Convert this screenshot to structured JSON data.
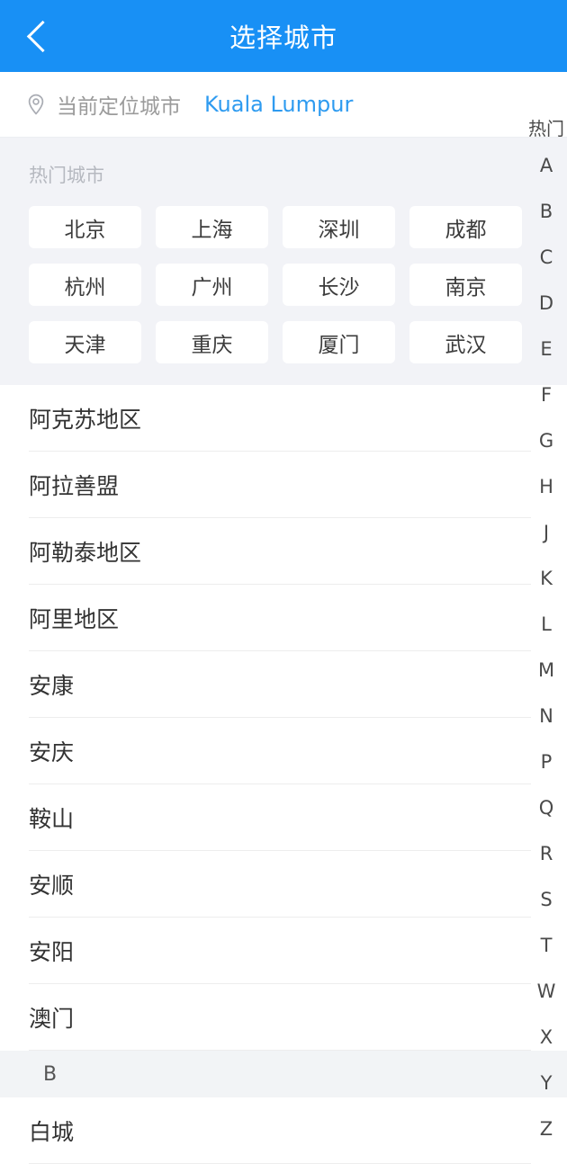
{
  "header": {
    "title": "选择城市",
    "back_icon": "chevron-left-icon",
    "background_color": "#1890f5",
    "title_color": "#ffffff"
  },
  "locate": {
    "icon": "location-pin-icon",
    "label": "当前定位城市",
    "value": "Kuala Lumpur",
    "value_color": "#2e9bf0",
    "label_color": "#9b9b9b"
  },
  "hot": {
    "title": "热门城市",
    "title_color": "#b6b9c0",
    "background_color": "#f2f3f7",
    "chips": [
      "北京",
      "上海",
      "深圳",
      "成都",
      "杭州",
      "广州",
      "长沙",
      "南京",
      "天津",
      "重庆",
      "厦门",
      "武汉"
    ]
  },
  "city_list": [
    {
      "type": "city",
      "name": "阿克苏地区"
    },
    {
      "type": "city",
      "name": "阿拉善盟"
    },
    {
      "type": "city",
      "name": "阿勒泰地区"
    },
    {
      "type": "city",
      "name": "阿里地区"
    },
    {
      "type": "city",
      "name": "安康"
    },
    {
      "type": "city",
      "name": "安庆"
    },
    {
      "type": "city",
      "name": "鞍山"
    },
    {
      "type": "city",
      "name": "安顺"
    },
    {
      "type": "city",
      "name": "安阳"
    },
    {
      "type": "city",
      "name": "澳门"
    },
    {
      "type": "section",
      "name": "B"
    },
    {
      "type": "city",
      "name": "白城"
    }
  ],
  "index_bar": {
    "items": [
      "热门",
      "A",
      "B",
      "C",
      "D",
      "E",
      "F",
      "G",
      "H",
      "J",
      "K",
      "L",
      "M",
      "N",
      "P",
      "Q",
      "R",
      "S",
      "T",
      "W",
      "X",
      "Y",
      "Z"
    ],
    "text_color": "#4a4a4a"
  }
}
